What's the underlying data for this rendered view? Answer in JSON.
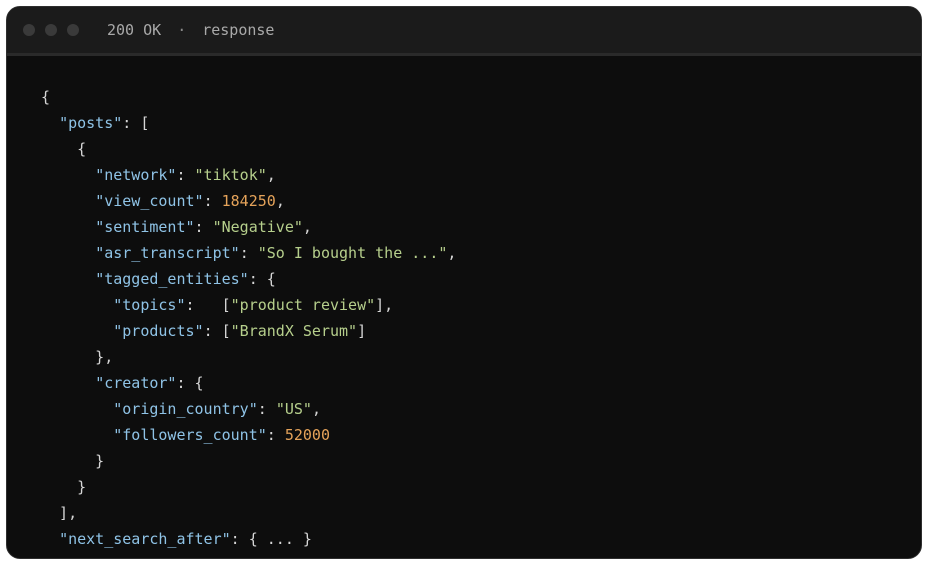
{
  "titlebar": {
    "status": "200 OK",
    "separator": "·",
    "label": "response"
  },
  "code_lines": [
    [
      {
        "t": "{",
        "c": "p"
      }
    ],
    [
      {
        "t": "  ",
        "c": "p"
      },
      {
        "t": "\"posts\"",
        "c": "k"
      },
      {
        "t": ": [",
        "c": "p"
      }
    ],
    [
      {
        "t": "    {",
        "c": "p"
      }
    ],
    [
      {
        "t": "      ",
        "c": "p"
      },
      {
        "t": "\"network\"",
        "c": "k"
      },
      {
        "t": ": ",
        "c": "p"
      },
      {
        "t": "\"tiktok\"",
        "c": "s"
      },
      {
        "t": ",",
        "c": "p"
      }
    ],
    [
      {
        "t": "      ",
        "c": "p"
      },
      {
        "t": "\"view_count\"",
        "c": "k"
      },
      {
        "t": ": ",
        "c": "p"
      },
      {
        "t": "184250",
        "c": "n"
      },
      {
        "t": ",",
        "c": "p"
      }
    ],
    [
      {
        "t": "      ",
        "c": "p"
      },
      {
        "t": "\"sentiment\"",
        "c": "k"
      },
      {
        "t": ": ",
        "c": "p"
      },
      {
        "t": "\"Negative\"",
        "c": "s"
      },
      {
        "t": ",",
        "c": "p"
      }
    ],
    [
      {
        "t": "      ",
        "c": "p"
      },
      {
        "t": "\"asr_transcript\"",
        "c": "k"
      },
      {
        "t": ": ",
        "c": "p"
      },
      {
        "t": "\"So I bought the ...\"",
        "c": "s"
      },
      {
        "t": ",",
        "c": "p"
      }
    ],
    [
      {
        "t": "      ",
        "c": "p"
      },
      {
        "t": "\"tagged_entities\"",
        "c": "k"
      },
      {
        "t": ": {",
        "c": "p"
      }
    ],
    [
      {
        "t": "        ",
        "c": "p"
      },
      {
        "t": "\"topics\"",
        "c": "k"
      },
      {
        "t": ":   [",
        "c": "p"
      },
      {
        "t": "\"product review\"",
        "c": "s"
      },
      {
        "t": "],",
        "c": "p"
      }
    ],
    [
      {
        "t": "        ",
        "c": "p"
      },
      {
        "t": "\"products\"",
        "c": "k"
      },
      {
        "t": ": [",
        "c": "p"
      },
      {
        "t": "\"BrandX Serum\"",
        "c": "s"
      },
      {
        "t": "]",
        "c": "p"
      }
    ],
    [
      {
        "t": "      },",
        "c": "p"
      }
    ],
    [
      {
        "t": "      ",
        "c": "p"
      },
      {
        "t": "\"creator\"",
        "c": "k"
      },
      {
        "t": ": {",
        "c": "p"
      }
    ],
    [
      {
        "t": "        ",
        "c": "p"
      },
      {
        "t": "\"origin_country\"",
        "c": "k"
      },
      {
        "t": ": ",
        "c": "p"
      },
      {
        "t": "\"US\"",
        "c": "s"
      },
      {
        "t": ",",
        "c": "p"
      }
    ],
    [
      {
        "t": "        ",
        "c": "p"
      },
      {
        "t": "\"followers_count\"",
        "c": "k"
      },
      {
        "t": ": ",
        "c": "p"
      },
      {
        "t": "52000",
        "c": "n"
      }
    ],
    [
      {
        "t": "      }",
        "c": "p"
      }
    ],
    [
      {
        "t": "    }",
        "c": "p"
      }
    ],
    [
      {
        "t": "  ],",
        "c": "p"
      }
    ],
    [
      {
        "t": "  ",
        "c": "p"
      },
      {
        "t": "\"next_search_after\"",
        "c": "k"
      },
      {
        "t": ": { ... }",
        "c": "p"
      }
    ],
    [
      {
        "t": "}",
        "c": "p"
      }
    ]
  ],
  "colors": {
    "key": "#8fc3e6",
    "string": "#b6cf8c",
    "number": "#e5a35a",
    "punct": "#d6d6d6",
    "background": "#0d0d0d"
  }
}
